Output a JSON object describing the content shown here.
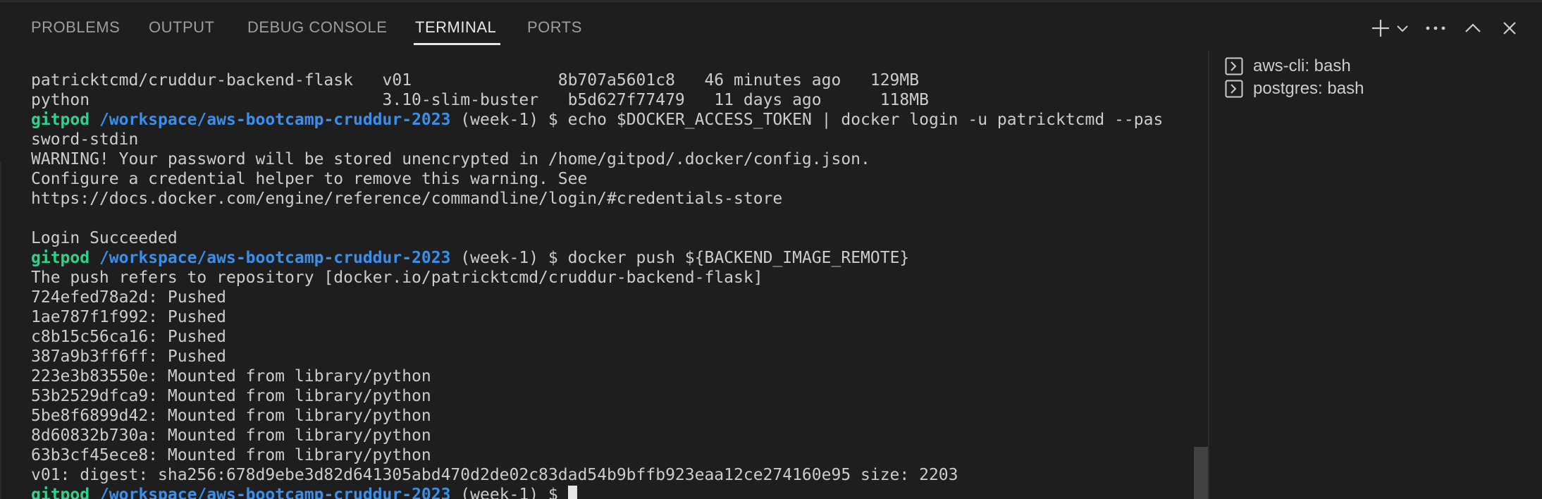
{
  "panel": {
    "tabs": [
      {
        "label": "PROBLEMS"
      },
      {
        "label": "OUTPUT"
      },
      {
        "label": "DEBUG CONSOLE"
      },
      {
        "label": "TERMINAL",
        "active": true
      },
      {
        "label": "PORTS"
      }
    ],
    "actions": [
      "plus-icon",
      "chevron-down-icon",
      "ellipsis-icon",
      "chevron-up-icon",
      "close-icon"
    ]
  },
  "terminal": {
    "prompt": {
      "user": "gitpod",
      "path": "/workspace/aws-bootcamp-cruddur-2023",
      "branch_suffix": " (week-1) $ "
    },
    "lines": [
      {
        "text": "patricktcmd/cruddur-backend-flask   v01               8b707a5601c8   46 minutes ago   129MB"
      },
      {
        "text": "python                              3.10-slim-buster   b5d627f77479   11 days ago      118MB"
      },
      {
        "prompt": true,
        "cmd": "echo $DOCKER_ACCESS_TOKEN | docker login -u patricktcmd --pas"
      },
      {
        "text": "sword-stdin"
      },
      {
        "text": "WARNING! Your password will be stored unencrypted in /home/gitpod/.docker/config.json."
      },
      {
        "text": "Configure a credential helper to remove this warning. See"
      },
      {
        "text": "https://docs.docker.com/engine/reference/commandline/login/#credentials-store"
      },
      {
        "text": ""
      },
      {
        "text": "Login Succeeded"
      },
      {
        "prompt": true,
        "cmd": "docker push ${BACKEND_IMAGE_REMOTE}"
      },
      {
        "text": "The push refers to repository [docker.io/patricktcmd/cruddur-backend-flask]"
      },
      {
        "text": "724efed78a2d: Pushed"
      },
      {
        "text": "1ae787f1f992: Pushed"
      },
      {
        "text": "c8b15c56ca16: Pushed"
      },
      {
        "text": "387a9b3ff6ff: Pushed"
      },
      {
        "text": "223e3b83550e: Mounted from library/python"
      },
      {
        "text": "53b2529dfca9: Mounted from library/python"
      },
      {
        "text": "5be8f6899d42: Mounted from library/python"
      },
      {
        "text": "8d60832b730a: Mounted from library/python"
      },
      {
        "text": "63b3cf45ece8: Mounted from library/python"
      },
      {
        "text": "v01: digest: sha256:678d9ebe3d82d641305abd470d2de02c83dad54b9bffb923eaa12ce274160e95 size: 2203"
      },
      {
        "prompt": true,
        "cmd": "",
        "cursor": true
      }
    ]
  },
  "terminal_list": {
    "items": [
      {
        "label": "aws-cli: bash",
        "icon": "terminal-icon"
      },
      {
        "label": "postgres: bash",
        "icon": "terminal-icon"
      }
    ]
  },
  "colors": {
    "background": "#1e1e1e",
    "prompt_user": "#2fd18f",
    "prompt_path": "#3b8eea",
    "text": "#cccccc"
  }
}
